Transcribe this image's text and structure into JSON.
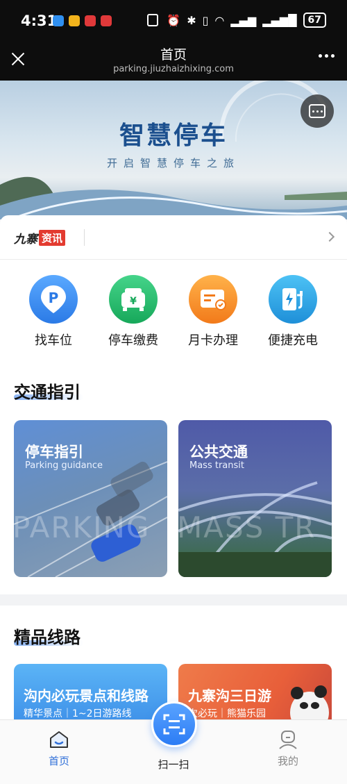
{
  "status_bar": {
    "time": "4:31",
    "battery": "67"
  },
  "header": {
    "title": "首页",
    "url": "parking.jiuzhaizhixing.com"
  },
  "banner": {
    "title": "智慧停车",
    "subtitle": "开启智慧停车之旅"
  },
  "news": {
    "brand": "九寨",
    "tag": "资讯"
  },
  "quick_actions": [
    {
      "label": "找车位",
      "icon": "parking-location-icon",
      "color": "#3c8df0"
    },
    {
      "label": "停车缴费",
      "icon": "car-payment-icon",
      "color": "#22b76a"
    },
    {
      "label": "月卡办理",
      "icon": "monthly-card-icon",
      "color": "#f58a2a"
    },
    {
      "label": "便捷充电",
      "icon": "charging-station-icon",
      "color": "#2a9ee0"
    }
  ],
  "traffic": {
    "title": "交通指引",
    "cards": [
      {
        "title": "停车指引",
        "subtitle": "Parking guidance",
        "watermark": "PARKING"
      },
      {
        "title": "公共交通",
        "subtitle": "Mass transit",
        "watermark": "MASS TR"
      }
    ]
  },
  "routes": {
    "title": "精品线路",
    "cards": [
      {
        "title": "沟内必玩景点和线路",
        "subtitle": "精华景点｜1~2日游路线"
      },
      {
        "title": "九寨沟三日游",
        "subtitle": "次必玩｜熊猫乐园"
      }
    ]
  },
  "bottom_nav": {
    "home": "首页",
    "scan": "扫一扫",
    "mine": "我的"
  },
  "colors": {
    "accent": "#2c7cf5",
    "home_active": "#2f6fd8"
  }
}
